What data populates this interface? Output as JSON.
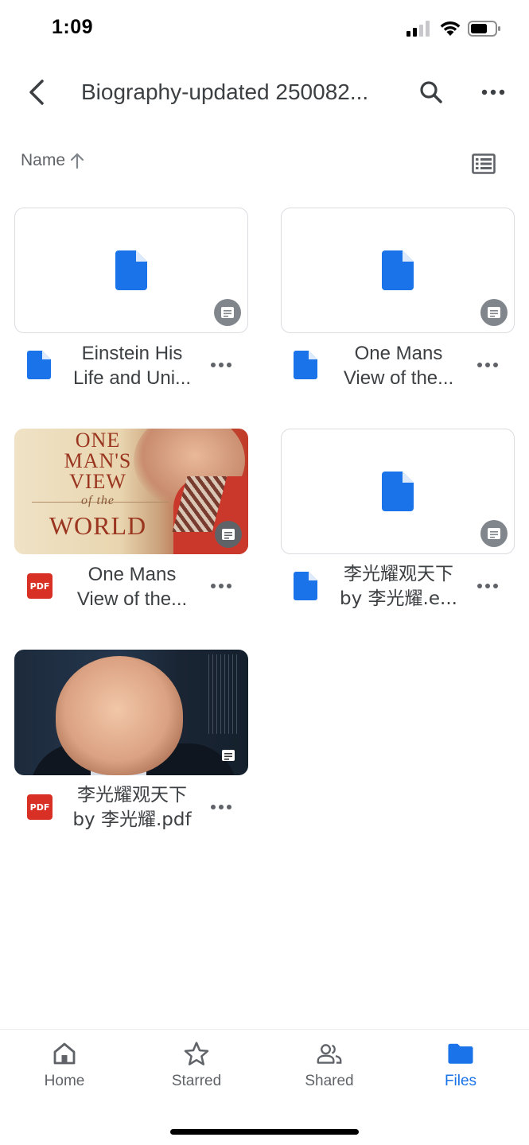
{
  "status_bar": {
    "time": "1:09"
  },
  "top_bar": {
    "title": "Biography-updated 250082..."
  },
  "sort": {
    "label": "Name"
  },
  "files": [
    {
      "name_line1": "Einstein His",
      "name_line2": "Life and Uni...",
      "type": "doc"
    },
    {
      "name_line1": "One Mans",
      "name_line2": "View of the...",
      "type": "doc"
    },
    {
      "name_line1": "One Mans",
      "name_line2": "View of the...",
      "type": "pdf"
    },
    {
      "name_line1": "李光耀观天下",
      "name_line2": "by 李光耀.e...",
      "type": "doc"
    },
    {
      "name_line1": "李光耀观天下",
      "name_line2": "by 李光耀.pdf",
      "type": "pdf"
    }
  ],
  "pdf_badge": "PDF",
  "cover_one_mans_view": {
    "line1": "ONE",
    "line2": "MAN'S",
    "line3": "VIEW",
    "line4": "of the",
    "line5": "WORLD"
  },
  "bottom_nav": [
    {
      "label": "Home",
      "active": false
    },
    {
      "label": "Starred",
      "active": false
    },
    {
      "label": "Shared",
      "active": false
    },
    {
      "label": "Files",
      "active": true
    }
  ],
  "colors": {
    "accent": "#1a73e8",
    "pdf_red": "#d93025",
    "doc_blue": "#1a73e8",
    "text": "#3c4043",
    "muted": "#5f6368"
  }
}
